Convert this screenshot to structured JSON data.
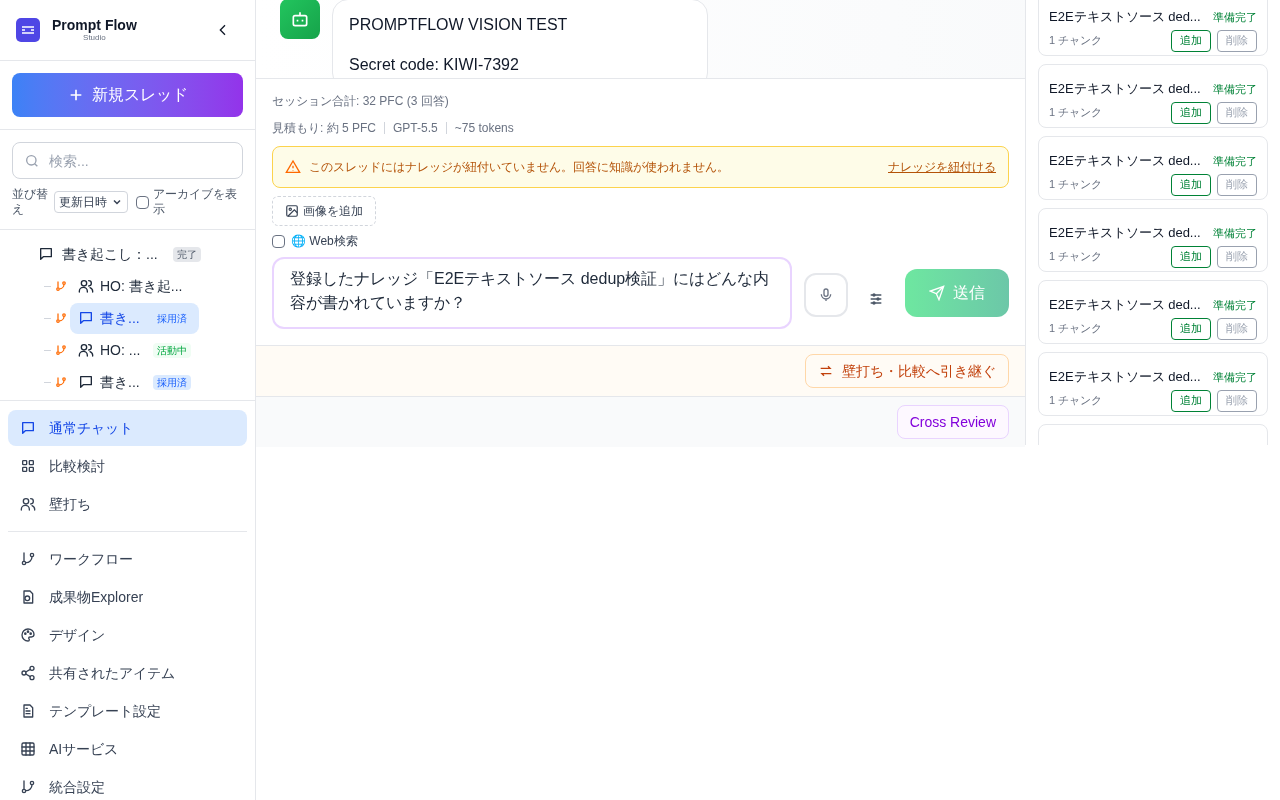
{
  "sidebar": {
    "brand": {
      "name": "Prompt Flow",
      "sub": "Studio"
    },
    "new_thread": "新規スレッド",
    "search": {
      "placeholder": "検索..."
    },
    "sort": {
      "label": "並び替え",
      "value": "更新日時"
    },
    "archive": {
      "label": "アーカイブを表示",
      "checked": false
    },
    "threads": [
      {
        "kind": "chat",
        "title": "書き起こし：...",
        "badge": {
          "text": "完了",
          "kind": "gray"
        },
        "selected": false,
        "children": [
          {
            "kind": "team",
            "title": "HO: 書き起...",
            "selected": false
          },
          {
            "kind": "chat",
            "title": "書き...",
            "badge": {
              "text": "採用済",
              "kind": "blue"
            },
            "selected": true
          },
          {
            "kind": "team",
            "title": "HO: ...",
            "badge": {
              "text": "活動中",
              "kind": "green"
            },
            "selected": false
          },
          {
            "kind": "chat",
            "title": "書き...",
            "badge": {
              "text": "採用済",
              "kind": "blue"
            },
            "selected": false
          }
        ]
      }
    ],
    "nav": [
      [
        {
          "kind": "chat",
          "label": "通常チャット",
          "selected": true
        },
        {
          "kind": "grid",
          "label": "比較検討",
          "selected": false
        },
        {
          "kind": "team",
          "label": "壁打ち",
          "selected": false
        }
      ],
      [
        {
          "kind": "branch",
          "label": "ワークフロー",
          "selected": false
        },
        {
          "kind": "file",
          "label": "成果物Explorer",
          "selected": false
        },
        {
          "kind": "palette",
          "label": "デザイン",
          "selected": false
        },
        {
          "kind": "share",
          "label": "共有されたアイテム",
          "selected": false
        },
        {
          "kind": "doc",
          "label": "テンプレート設定",
          "selected": false
        },
        {
          "kind": "table",
          "label": "AIサービス",
          "selected": false
        },
        {
          "kind": "branch",
          "label": "統合設定",
          "selected": false
        }
      ]
    ]
  },
  "main": {
    "message": {
      "lines": [
        "PROMPTFLOW VISION TEST",
        "Secret code: KIWI-7392"
      ]
    },
    "session_total": "セッション合計: 32 PFC (3 回答)",
    "estimate": [
      "見積もり: 約 5 PFC",
      "GPT-5.5",
      "~75 tokens"
    ],
    "warning": {
      "text": "このスレッドにはナレッジが紐付いていません。回答に知識が使われません。",
      "link": "ナレッジを紐付ける"
    },
    "add_image": "画像を追加",
    "web_search": {
      "label": "🌐 Web検索",
      "checked": false
    },
    "prompt": "登録したナレッジ「E2Eテキストソース dedup検証」にはどんな内容が書かれていますか？",
    "send": "送信",
    "handover": "壁打ち・比較へ引き継ぐ",
    "cross_review": "Cross Review"
  },
  "knowledge": [
    {
      "title": "E2Eテキストソース ded...",
      "status": "準備完了",
      "chunks": "1 チャンク",
      "add": "追加",
      "delete": "削除"
    },
    {
      "title": "E2Eテキストソース ded...",
      "status": "準備完了",
      "chunks": "1 チャンク",
      "add": "追加",
      "delete": "削除"
    },
    {
      "title": "E2Eテキストソース ded...",
      "status": "準備完了",
      "chunks": "1 チャンク",
      "add": "追加",
      "delete": "削除"
    },
    {
      "title": "E2Eテキストソース ded...",
      "status": "準備完了",
      "chunks": "1 チャンク",
      "add": "追加",
      "delete": "削除"
    },
    {
      "title": "E2Eテキストソース ded...",
      "status": "準備完了",
      "chunks": "1 チャンク",
      "add": "追加",
      "delete": "削除"
    },
    {
      "title": "E2Eテキストソース ded...",
      "status": "準備完了",
      "chunks": "1 チャンク",
      "add": "追加",
      "delete": "削除"
    }
  ]
}
